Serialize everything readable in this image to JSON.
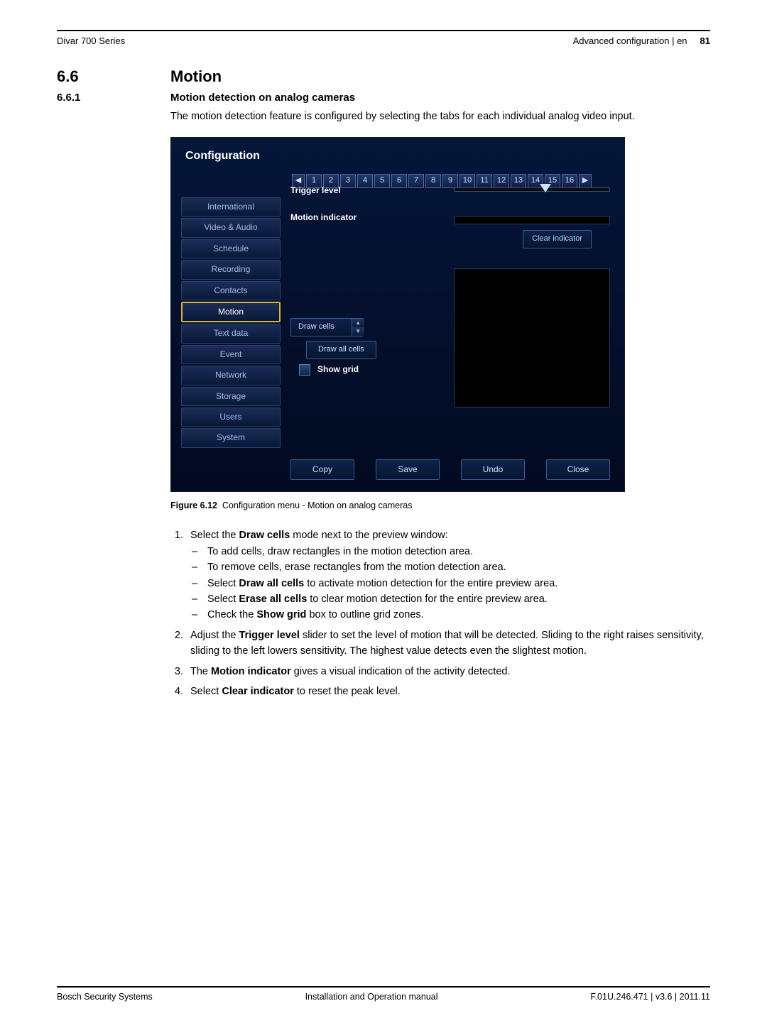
{
  "header": {
    "left": "Divar 700 Series",
    "right_text": "Advanced configuration | en",
    "page": "81"
  },
  "section": {
    "num": "6.6",
    "title": "Motion",
    "sub_num": "6.6.1",
    "sub_title": "Motion detection on analog cameras",
    "intro": "The motion detection feature is configured by selecting the tabs for each individual analog video input."
  },
  "config": {
    "title": "Configuration",
    "tabs": [
      "1",
      "2",
      "3",
      "4",
      "5",
      "6",
      "7",
      "8",
      "9",
      "10",
      "11",
      "12",
      "13",
      "14",
      "15",
      "16"
    ],
    "arrow_left": "◀",
    "arrow_right": "▶",
    "sidebar": [
      "International",
      "Video & Audio",
      "Schedule",
      "Recording",
      "Contacts",
      "Motion",
      "Text data",
      "Event",
      "Network",
      "Storage",
      "Users",
      "System"
    ],
    "sidebar_active_index": 5,
    "trigger_label": "Trigger level",
    "motion_label": "Motion indicator",
    "clear_indicator": "Clear indicator",
    "draw_cells": "Draw cells",
    "draw_all_cells": "Draw all cells",
    "show_grid": "Show grid",
    "buttons": {
      "copy": "Copy",
      "save": "Save",
      "undo": "Undo",
      "close": "Close"
    }
  },
  "figure_caption": {
    "label": "Figure 6.12",
    "text": "Configuration menu - Motion on analog cameras"
  },
  "steps": {
    "s1_intro": "Select the ",
    "s1_b": "Draw cells",
    "s1_after": " mode next to the preview window:",
    "s1_sub1": "To add cells, draw rectangles in the motion detection area.",
    "s1_sub2": "To remove cells, erase rectangles from the motion detection area.",
    "s1_sub3a": "Select ",
    "s1_sub3b": "Draw all cells",
    "s1_sub3c": " to activate motion detection for the entire preview area.",
    "s1_sub4a": "Select ",
    "s1_sub4b": "Erase all cells",
    "s1_sub4c": " to clear motion detection for the entire preview area.",
    "s1_sub5a": "Check the ",
    "s1_sub5b": "Show grid",
    "s1_sub5c": " box to outline grid zones.",
    "s2a": "Adjust the ",
    "s2b": "Trigger level",
    "s2c": " slider to set the level of motion that will be detected. Sliding to the right raises sensitivity, sliding to the left lowers sensitivity. The highest value detects even the slightest motion.",
    "s3a": "The ",
    "s3b": "Motion indicator",
    "s3c": " gives a visual indication of the activity detected.",
    "s4a": "Select ",
    "s4b": "Clear indicator",
    "s4c": " to reset the peak level."
  },
  "footer": {
    "left": "Bosch Security Systems",
    "center": "Installation and Operation manual",
    "right": "F.01U.246.471 | v3.6 | 2011.11"
  }
}
